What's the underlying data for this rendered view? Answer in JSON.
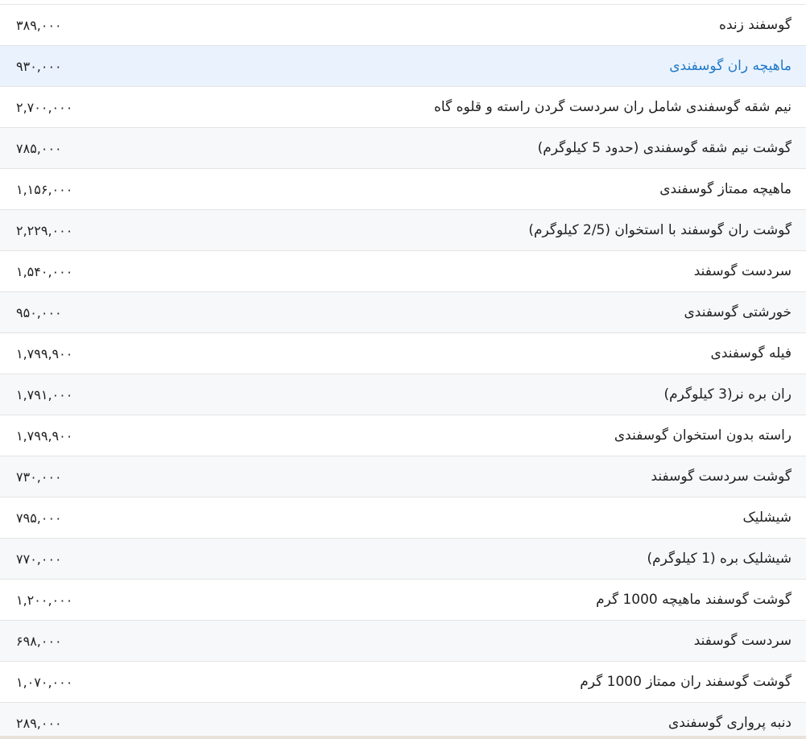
{
  "colors": {
    "row_even": "#f7f8fa",
    "row_odd": "#ffffff",
    "active_row": "#eaf3fd",
    "active_text": "#1f78c8",
    "border": "#e4e4e4"
  },
  "rows": [
    {
      "name": "گوسفند زنده",
      "price": "۳۸۹,۰۰۰"
    },
    {
      "name": "ماهیچه ران گوسفندی",
      "price": "۹۳۰,۰۰۰"
    },
    {
      "name": "نیم شقه گوسفندی شامل ران سردست گردن راسته و قلوه گاه",
      "price": "۲,۷۰۰,۰۰۰"
    },
    {
      "name": "گوشت نیم شقه گوسفندی (حدود 5 کیلوگرم)",
      "price": "۷۸۵,۰۰۰"
    },
    {
      "name": "ماهیچه ممتاز گوسفندی",
      "price": "۱,۱۵۶,۰۰۰"
    },
    {
      "name": "گوشت ران گوسفند با استخوان (2/5 کیلوگرم)",
      "price": "۲,۲۲۹,۰۰۰"
    },
    {
      "name": "سردست گوسفند",
      "price": "۱,۵۴۰,۰۰۰"
    },
    {
      "name": "خورشتی گوسفندی",
      "price": "۹۵۰,۰۰۰"
    },
    {
      "name": "فیله گوسفندی",
      "price": "۱,۷۹۹,۹۰۰"
    },
    {
      "name": "ران بره نر(3 کیلوگرم)",
      "price": "۱,۷۹۱,۰۰۰"
    },
    {
      "name": "راسته بدون استخوان گوسفندی",
      "price": "۱,۷۹۹,۹۰۰"
    },
    {
      "name": "گوشت سردست گوسفند",
      "price": "۷۳۰,۰۰۰"
    },
    {
      "name": "شیشلیک",
      "price": "۷۹۵,۰۰۰"
    },
    {
      "name": "شیشلیک بره (1 کیلوگرم)",
      "price": "۷۷۰,۰۰۰"
    },
    {
      "name": "گوشت گوسفند ماهیچه 1000 گرم",
      "price": "۱,۲۰۰,۰۰۰"
    },
    {
      "name": "سردست گوسفند",
      "price": "۶۹۸,۰۰۰"
    },
    {
      "name": "گوشت گوسفند ران ممتاز 1000 گرم",
      "price": "۱,۰۷۰,۰۰۰"
    },
    {
      "name": "دنبه پرواری گوسفندی",
      "price": "۲۸۹,۰۰۰"
    }
  ]
}
